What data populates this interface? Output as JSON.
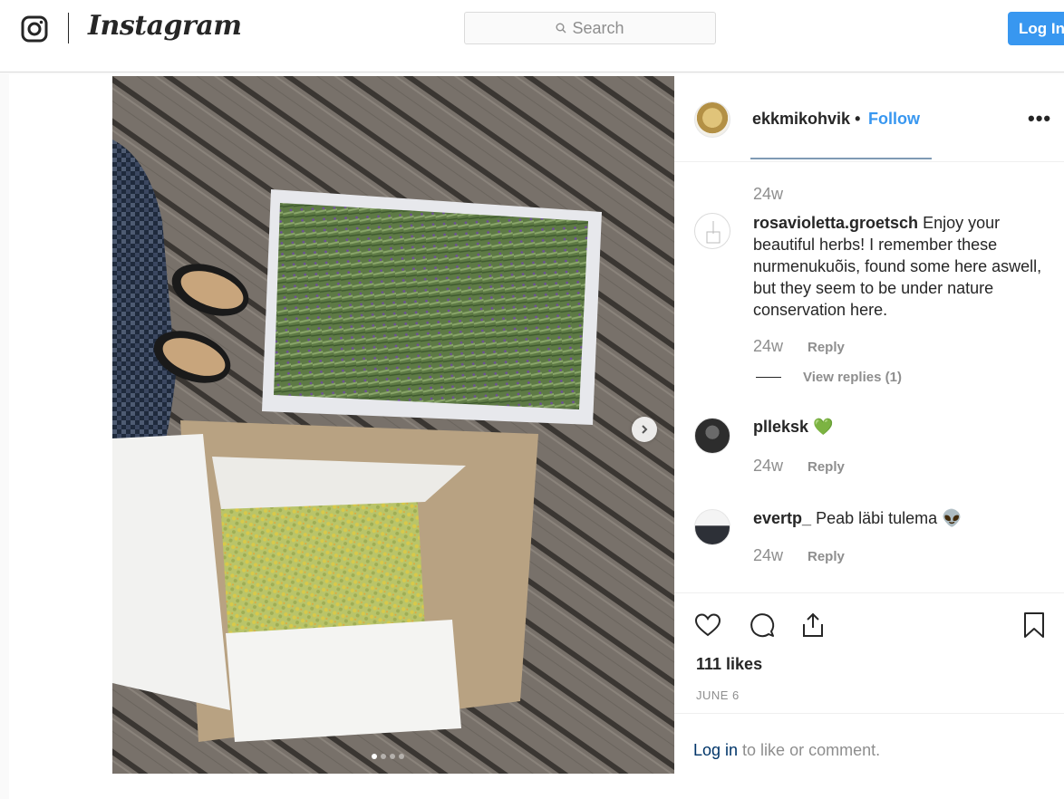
{
  "nav": {
    "brand": "Instagram",
    "search_placeholder": "Search",
    "login_label": "Log In"
  },
  "post": {
    "username": "ekkmikohvik",
    "separator": " • ",
    "follow_label": "Follow",
    "more_label": "•••",
    "carousel": {
      "current": 1,
      "total": 4
    },
    "likes": "111 likes",
    "date": "JUNE 6"
  },
  "comments": [
    {
      "time": "24w"
    },
    {
      "username": "rosavioletta.groetsch",
      "text": "Enjoy your beautiful herbs! I remember these nurmenukuõis, found some here aswell, but they seem to be under nature conservation here.",
      "time": "24w",
      "reply_label": "Reply",
      "view_replies": "View replies (1)"
    },
    {
      "username": "plleksk",
      "text": "💚",
      "time": "24w",
      "reply_label": "Reply"
    },
    {
      "username": "evertp_",
      "text": "Peab läbi tulema 👽",
      "time": "24w",
      "reply_label": "Reply"
    }
  ],
  "footer": {
    "login_link": "Log in",
    "login_suffix": " to like or comment."
  },
  "colors": {
    "accent": "#3897f0",
    "link": "#003569",
    "muted": "#8e8e8e"
  },
  "icons": [
    "instagram-glyph-icon",
    "search-icon",
    "chevron-right-icon",
    "heart-icon",
    "comment-icon",
    "share-icon",
    "bookmark-icon"
  ]
}
